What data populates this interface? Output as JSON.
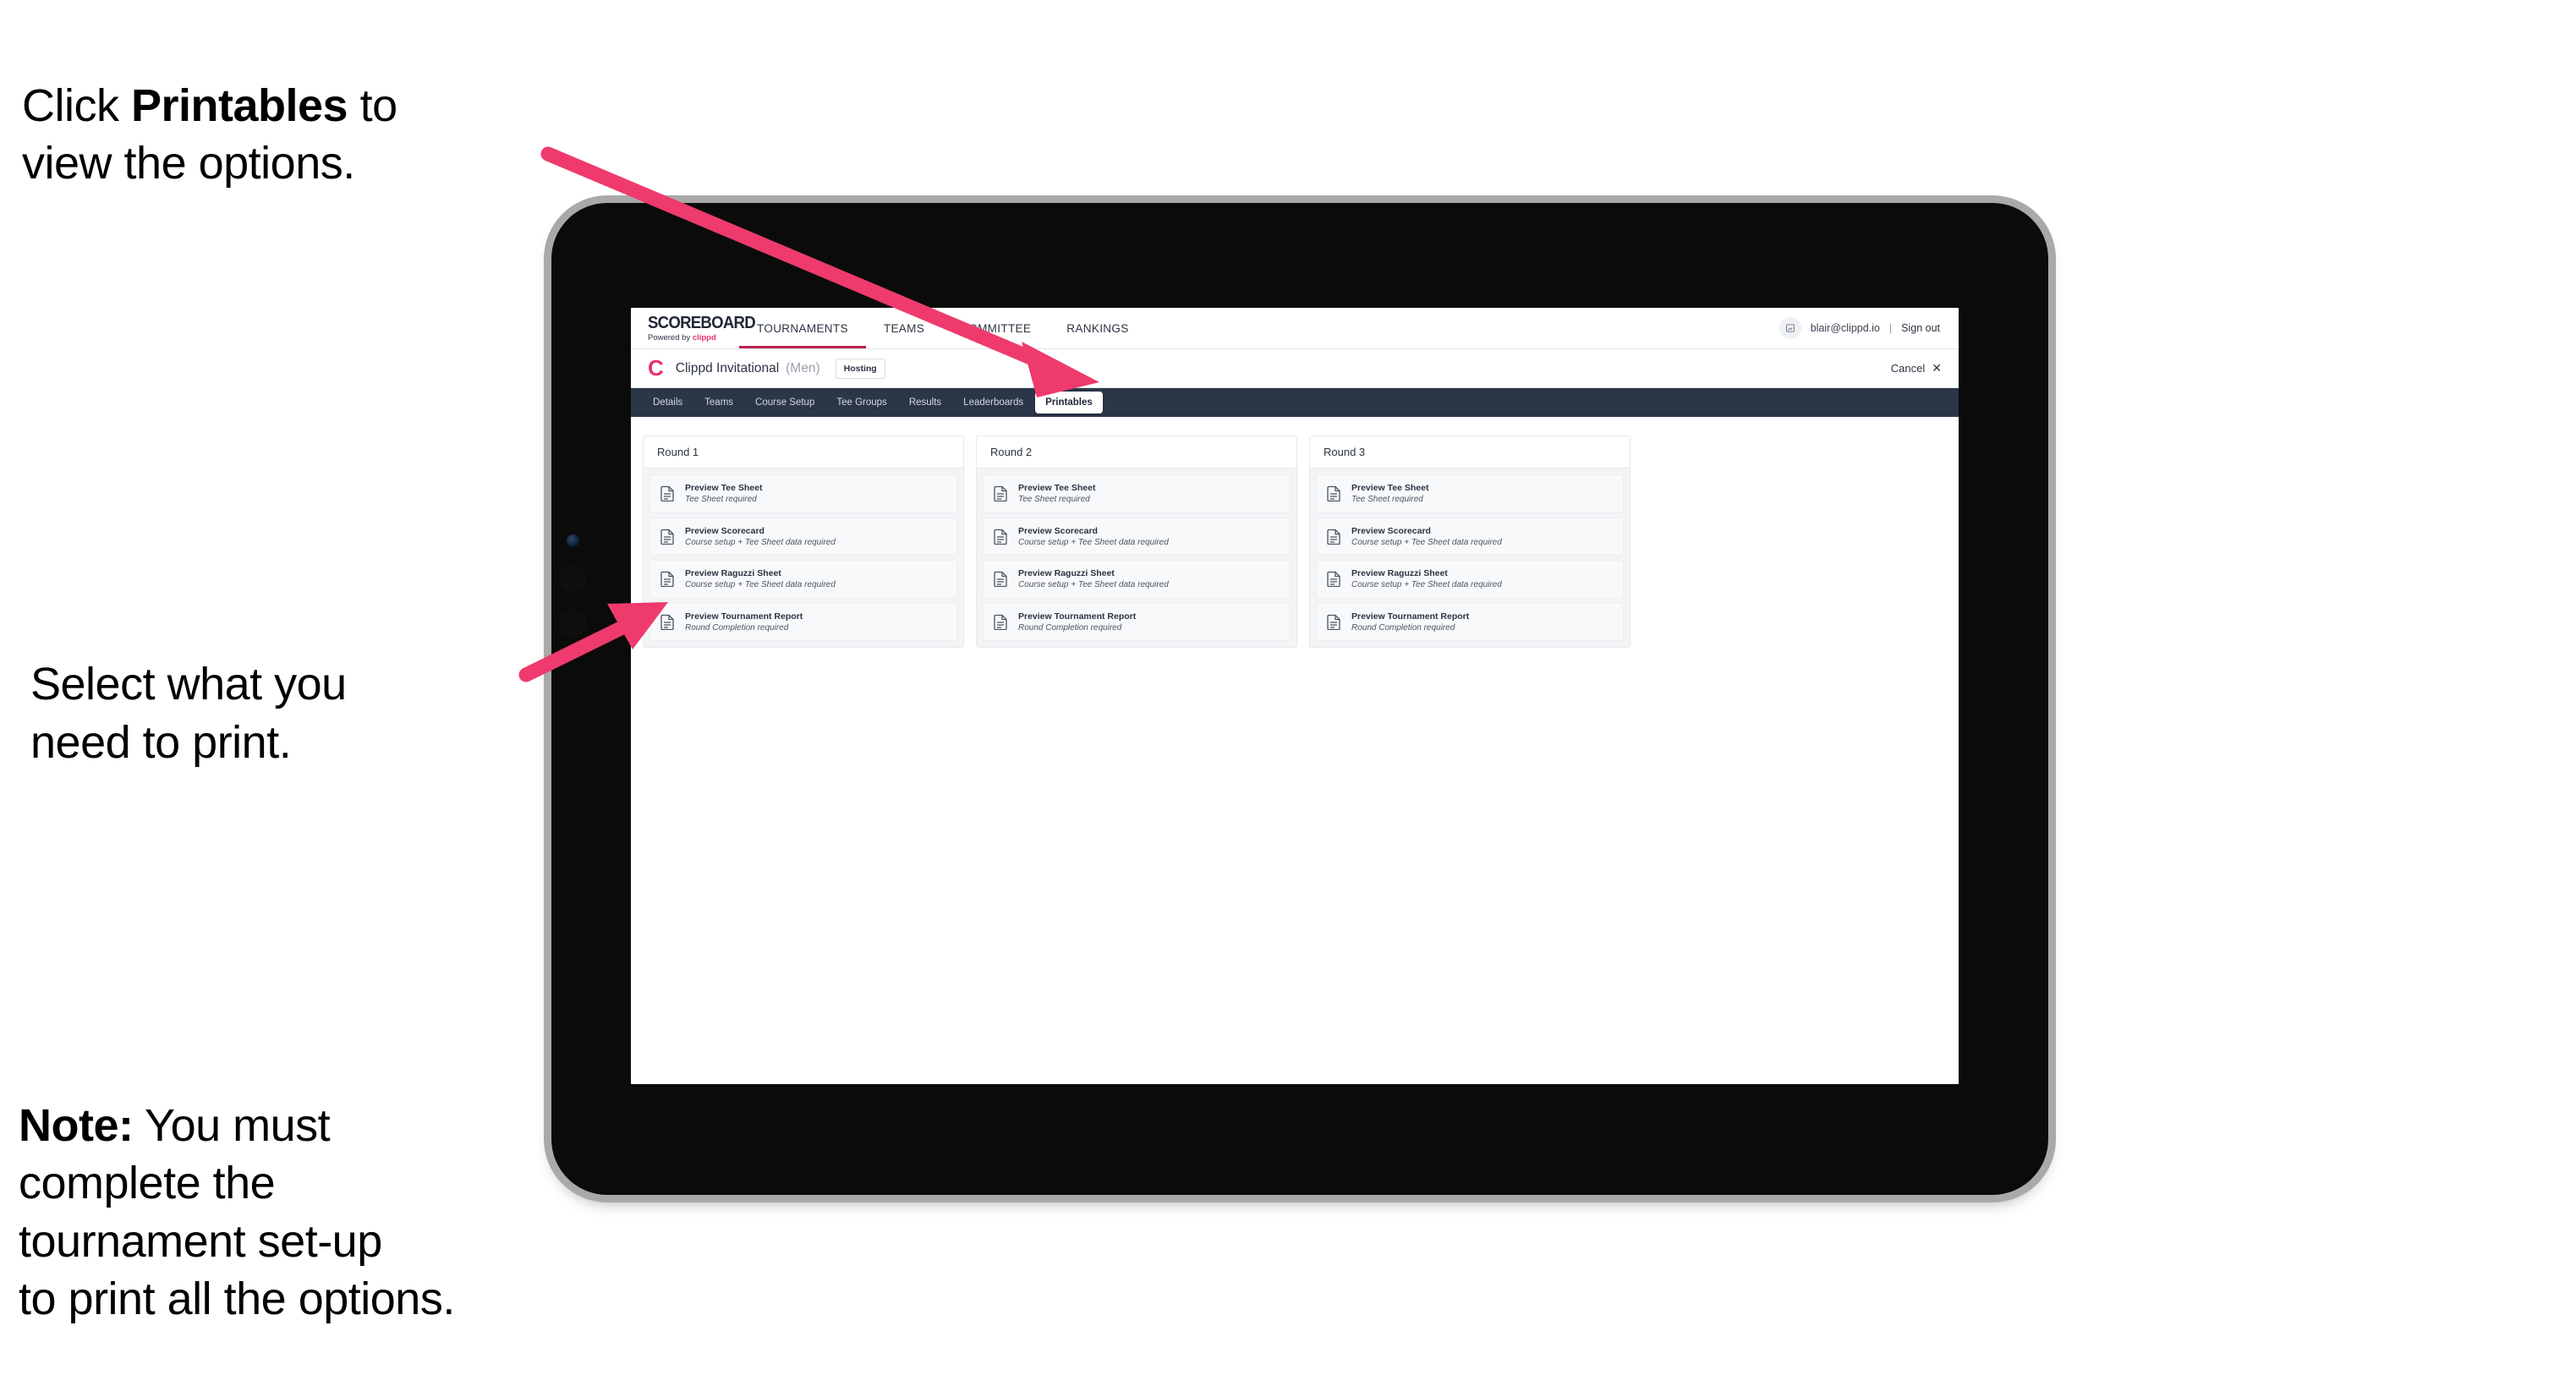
{
  "annotations": {
    "click_printables": "Click Printables to\nview the options.",
    "click_printables_prefix": "Click ",
    "click_printables_bold": "Printables",
    "click_printables_suffix": " to\nview the options.",
    "select_print": "Select what you\n need to print.",
    "note_bold": "Note:",
    "note_rest": " You must\ncomplete the\ntournament set-up\nto print all the options.",
    "arrow_color": "#ef3a6d"
  },
  "app": {
    "brand": {
      "title": "SCOREBOARD",
      "powered_prefix": "Powered by ",
      "powered_brand": "clippd"
    },
    "topnav": [
      {
        "label": "TOURNAMENTS",
        "active": true
      },
      {
        "label": "TEAMS",
        "active": false
      },
      {
        "label": "COMMITTEE",
        "active": false
      },
      {
        "label": "RANKINGS",
        "active": false
      }
    ],
    "header_right": {
      "avatar_icon": "user-avatar-icon",
      "email": "blair@clippd.io",
      "separator": "|",
      "sign_out": "Sign out"
    },
    "tournament_bar": {
      "logo_mark": "C",
      "name": "Clippd Invitational",
      "gender": "(Men)",
      "hosting_badge": "Hosting",
      "cancel_label": "Cancel",
      "cancel_icon": "close-icon"
    },
    "subnav": [
      {
        "label": "Details",
        "active": false
      },
      {
        "label": "Teams",
        "active": false
      },
      {
        "label": "Course Setup",
        "active": false
      },
      {
        "label": "Tee Groups",
        "active": false
      },
      {
        "label": "Results",
        "active": false
      },
      {
        "label": "Leaderboards",
        "active": false
      },
      {
        "label": "Printables",
        "active": true
      }
    ],
    "rounds": [
      {
        "title": "Round 1",
        "items": [
          {
            "title": "Preview Tee Sheet",
            "sub": "Tee Sheet required"
          },
          {
            "title": "Preview Scorecard",
            "sub": "Course setup + Tee Sheet data required"
          },
          {
            "title": "Preview Raguzzi Sheet",
            "sub": "Course setup + Tee Sheet data required"
          },
          {
            "title": "Preview Tournament Report",
            "sub": "Round Completion required"
          }
        ]
      },
      {
        "title": "Round 2",
        "items": [
          {
            "title": "Preview Tee Sheet",
            "sub": "Tee Sheet required"
          },
          {
            "title": "Preview Scorecard",
            "sub": "Course setup + Tee Sheet data required"
          },
          {
            "title": "Preview Raguzzi Sheet",
            "sub": "Course setup + Tee Sheet data required"
          },
          {
            "title": "Preview Tournament Report",
            "sub": "Round Completion required"
          }
        ]
      },
      {
        "title": "Round 3",
        "items": [
          {
            "title": "Preview Tee Sheet",
            "sub": "Tee Sheet required"
          },
          {
            "title": "Preview Scorecard",
            "sub": "Course setup + Tee Sheet data required"
          },
          {
            "title": "Preview Raguzzi Sheet",
            "sub": "Course setup + Tee Sheet data required"
          },
          {
            "title": "Preview Tournament Report",
            "sub": "Round Completion required"
          }
        ]
      }
    ],
    "colors": {
      "accent_pink": "#e8336b",
      "subnav_bg": "#2b3648",
      "active_tab_underline": "#b9234b"
    }
  }
}
